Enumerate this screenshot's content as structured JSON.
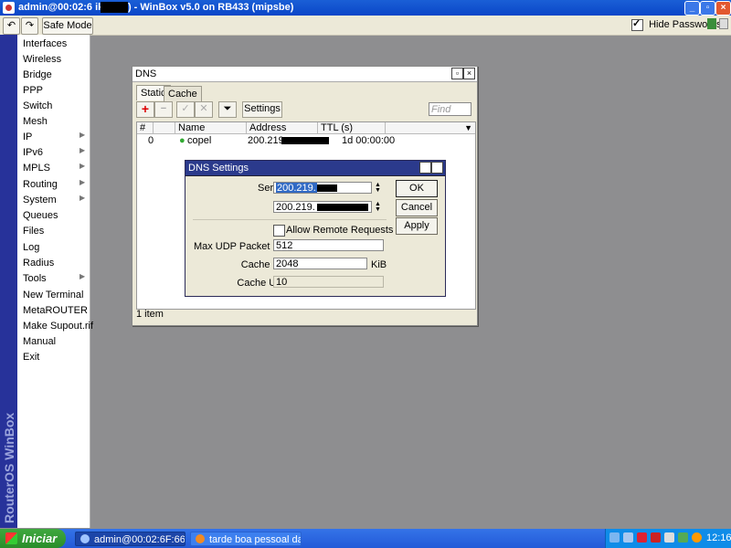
{
  "window": {
    "title": "admin@00:02:6F:66:…:MikroTik) - WinBox v5.0 on RB433 (mipsbe)",
    "title_visible": "admin@00:02:6   ikroTik) - WinBox v5.0 on RB433 (mipsbe)"
  },
  "toolbar": {
    "undo_icon": "undo-icon",
    "redo_icon": "redo-icon",
    "safe_mode_label": "Safe Mode",
    "hide_passwords_label": "Hide Passwords",
    "hide_passwords_checked": true
  },
  "sidebar": {
    "brand": "RouterOS WinBox",
    "items": [
      {
        "label": "Interfaces",
        "submenu": false
      },
      {
        "label": "Wireless",
        "submenu": false
      },
      {
        "label": "Bridge",
        "submenu": false
      },
      {
        "label": "PPP",
        "submenu": false
      },
      {
        "label": "Switch",
        "submenu": false
      },
      {
        "label": "Mesh",
        "submenu": false
      },
      {
        "label": "IP",
        "submenu": true
      },
      {
        "label": "IPv6",
        "submenu": true
      },
      {
        "label": "MPLS",
        "submenu": true
      },
      {
        "label": "Routing",
        "submenu": true
      },
      {
        "label": "System",
        "submenu": true
      },
      {
        "label": "Queues",
        "submenu": false
      },
      {
        "label": "Files",
        "submenu": false
      },
      {
        "label": "Log",
        "submenu": false
      },
      {
        "label": "Radius",
        "submenu": false
      },
      {
        "label": "Tools",
        "submenu": true
      },
      {
        "label": "New Terminal",
        "submenu": false
      },
      {
        "label": "MetaROUTER",
        "submenu": false
      },
      {
        "label": "Make Supout.rif",
        "submenu": false
      },
      {
        "label": "Manual",
        "submenu": false
      },
      {
        "label": "Exit",
        "submenu": false
      }
    ]
  },
  "dns_window": {
    "title": "DNS",
    "tabs": [
      "Static",
      "Cache"
    ],
    "active_tab": "Static",
    "settings_button": "Settings",
    "find_placeholder": "Find",
    "columns": [
      "#",
      "Name",
      "Address",
      "TTL (s)"
    ],
    "rows": [
      {
        "index": "0",
        "name": "copel",
        "address": "200.219.",
        "ttl": "1d 00:00:00"
      }
    ],
    "status": "1 item"
  },
  "dns_settings": {
    "title": "DNS Settings",
    "servers_label": "Servers:",
    "server1": "200.219.",
    "server2": "200.219.",
    "allow_remote_label": "Allow Remote Requests",
    "allow_remote_checked": false,
    "max_udp_label": "Max UDP Packet Size:",
    "max_udp_value": "512",
    "cache_size_label": "Cache Size:",
    "cache_size_value": "2048",
    "cache_size_unit": "KiB",
    "cache_used_label": "Cache Used:",
    "cache_used_value": "10",
    "ok_label": "OK",
    "cancel_label": "Cancel",
    "apply_label": "Apply"
  },
  "taskbar": {
    "start_label": "Iniciar",
    "tasks": [
      {
        "label": "admin@00:02:6F:66:...",
        "active": true
      },
      {
        "label": "tarde boa pessoal da ...",
        "active": false
      }
    ],
    "clock": "12:16"
  },
  "colors": {
    "desktop": "#8e8e90",
    "titlebar": "#0a46c8",
    "sidebar_brand": "#27329a",
    "dialog_title": "#2b3a8c",
    "selection": "#316ac5"
  }
}
